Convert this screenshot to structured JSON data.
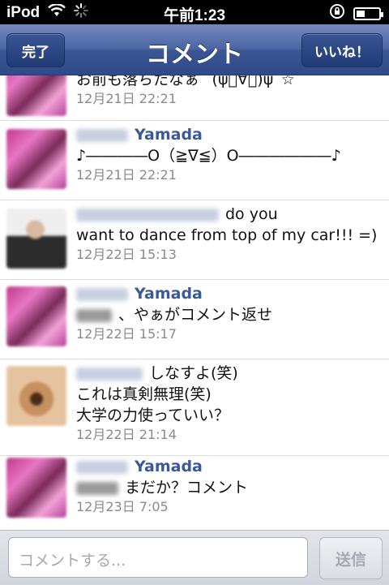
{
  "status": {
    "carrier": "iPod",
    "time": "午前1:23"
  },
  "nav": {
    "title": "コメント",
    "done_label": "完了",
    "like_label": "いいね！"
  },
  "comments": [
    {
      "name": "",
      "text": [
        "お前も落ちたなぁ ´(ψ゚∀゚)ψ`☆"
      ],
      "date": "12月21日 22:21"
    },
    {
      "name": "Yamada",
      "text": [
        "♪――――O（≧∇≦）O――――――♪"
      ],
      "date": "12月21日 22:21"
    },
    {
      "name": "",
      "text": [
        "do you",
        "want to dance from top of my car!!! =)"
      ],
      "date": "12月22日 15:13"
    },
    {
      "name": "Yamada",
      "text": [
        "、やぁがコメント返せ"
      ],
      "date": "12月22日 15:17"
    },
    {
      "name": "",
      "text": [
        "しなすよ(笑)",
        "これは真剣無理(笑)",
        "大学の力使っていい？"
      ],
      "date": "12月22日 21:14"
    },
    {
      "name": "Yamada",
      "text": [
        "まだか？コメント"
      ],
      "date": "12月23日 7:05"
    }
  ],
  "composer": {
    "placeholder": "コメントする...",
    "send_label": "送信"
  }
}
